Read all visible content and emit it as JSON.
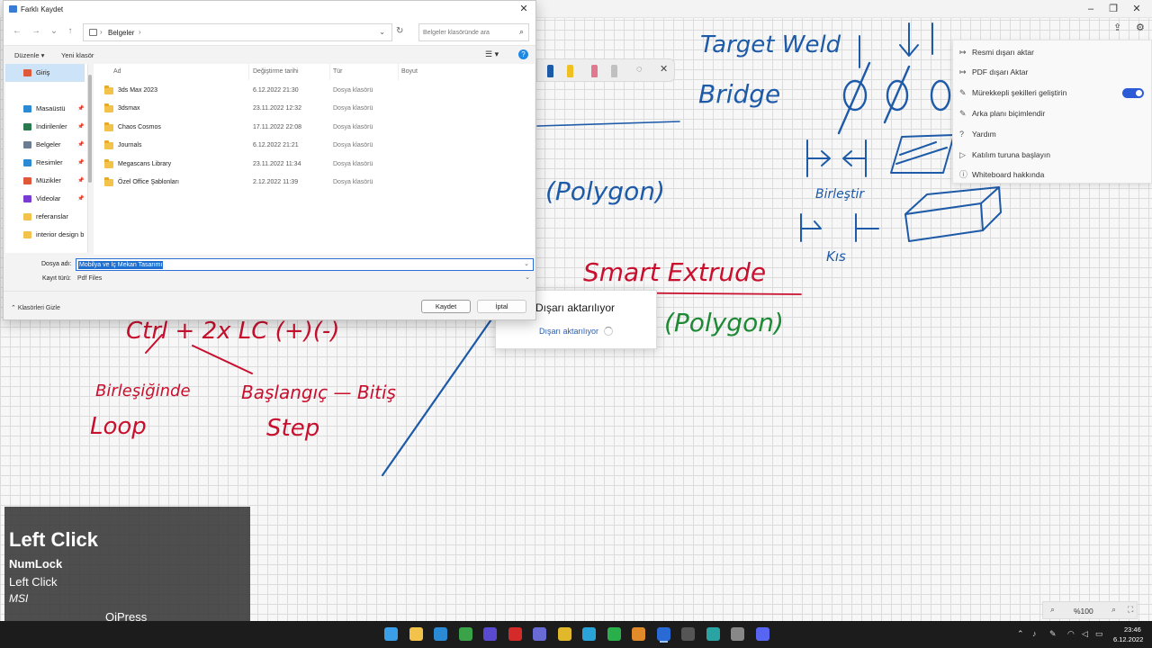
{
  "save_dialog": {
    "title": "Farklı Kaydet",
    "address_path": "Belgeler",
    "search_placeholder": "Belgeler klasöründe ara",
    "cmd_organize": "Düzenle",
    "cmd_new_folder": "Yeni klasör",
    "help": "?",
    "nav_items": [
      {
        "label": "Giriş",
        "icon": "home-icon",
        "color": "#e05a3a"
      },
      {
        "label": "Masaüstü",
        "icon": "desktop-icon",
        "color": "#2a8ad4"
      },
      {
        "label": "İndirilenler",
        "icon": "download-icon",
        "color": "#2a7a50"
      },
      {
        "label": "Belgeler",
        "icon": "documents-icon",
        "color": "#6b7c93"
      },
      {
        "label": "Resimler",
        "icon": "pictures-icon",
        "color": "#2a8ad4"
      },
      {
        "label": "Müzikler",
        "icon": "music-icon",
        "color": "#e0573a"
      },
      {
        "label": "Videolar",
        "icon": "videos-icon",
        "color": "#7a3ad4"
      },
      {
        "label": "referanslar",
        "icon": "folder-icon",
        "color": "#f2c24b"
      },
      {
        "label": "interior design b",
        "icon": "folder-icon",
        "color": "#f2c24b"
      }
    ],
    "columns": {
      "name": "Ad",
      "date": "Değiştirme tarihi",
      "type": "Tür",
      "size": "Boyut"
    },
    "files": [
      {
        "name": "3ds Max 2023",
        "date": "6.12.2022 21:30",
        "type": "Dosya klasörü"
      },
      {
        "name": "3dsmax",
        "date": "23.11.2022 12:32",
        "type": "Dosya klasörü"
      },
      {
        "name": "Chaos Cosmos",
        "date": "17.11.2022 22:08",
        "type": "Dosya klasörü"
      },
      {
        "name": "Journals",
        "date": "6.12.2022 21:21",
        "type": "Dosya klasörü"
      },
      {
        "name": "Megascans Library",
        "date": "23.11.2022 11:34",
        "type": "Dosya klasörü"
      },
      {
        "name": "Özel Office Şablonları",
        "date": "2.12.2022 11:39",
        "type": "Dosya klasörü"
      }
    ],
    "filename_label": "Dosya adı:",
    "filename_value": "Mobilya ve İç Mekan Tasarımı",
    "filetype_label": "Kayıt türü:",
    "filetype_value": "Pdf Files",
    "hide_folders": "Klasörleri Gizle",
    "save_button": "Kaydet",
    "cancel_button": "İptal"
  },
  "wb_menu": [
    {
      "label": "Resmi dışarı aktar",
      "icon": "export-image-icon"
    },
    {
      "label": "PDF dışarı Aktar",
      "icon": "export-pdf-icon"
    },
    {
      "label": "Mürekkepli şekilleri geliştirin",
      "icon": "ink-shape-icon",
      "toggle_on": true
    },
    {
      "label": "Arka planı biçimlendir",
      "icon": "background-icon"
    },
    {
      "label": "Yardım",
      "icon": "help-icon"
    },
    {
      "label": "Katılım turuna başlayın",
      "icon": "play-icon"
    },
    {
      "label": "Whiteboard hakkında",
      "icon": "info-icon"
    }
  ],
  "export_dialog": {
    "title": "Dışarı aktarılıyor",
    "status": "Dışarı aktarılıyor"
  },
  "ink_text": {
    "target_weld": "Target Weld",
    "bridge": "Bridge",
    "polygon_blue": "(Polygon)",
    "smart_extrude": "Smart Extrude",
    "polygon_green": "(Polygon)",
    "ctrl_line": "Ctrl + 2x LC (+)(-)",
    "birlestir": "Birleştir",
    "kis": "Kıs",
    "birlesiginde": "Birleşiğinde",
    "loop": "Loop",
    "baslangic": "Başlangıç — Bitiş",
    "step": "Step"
  },
  "key_overlay": {
    "line1": "Left Click",
    "line2": "NumLock",
    "line3": "Left Click",
    "line4": "MSI",
    "brand": "QiPress"
  },
  "zoom": {
    "value": "%100",
    "minus": "−",
    "plus": "+"
  },
  "taskbar": {
    "time": "23:46",
    "date": "6.12.2022",
    "apps": [
      {
        "name": "start-icon",
        "color": "#3a9ee8"
      },
      {
        "name": "file-explorer-icon",
        "color": "#f2c24b"
      },
      {
        "name": "edge-icon",
        "color": "#2a8ad4"
      },
      {
        "name": "upwork-icon",
        "color": "#3aa34a"
      },
      {
        "name": "obs-icon",
        "color": "#5a4ad0"
      },
      {
        "name": "anydesk-icon",
        "color": "#d42a2a"
      },
      {
        "name": "teams-icon",
        "color": "#6a6ad4"
      },
      {
        "name": "chrome-icon",
        "color": "#e0b82a"
      },
      {
        "name": "telegram-icon",
        "color": "#2aa3d8"
      },
      {
        "name": "whatsapp-icon",
        "color": "#2ab04a"
      },
      {
        "name": "app-orange-icon",
        "color": "#e08a2a"
      },
      {
        "name": "whiteboard-icon",
        "color": "#2a6ad4"
      },
      {
        "name": "xd-icon",
        "color": "#555555"
      },
      {
        "name": "3dsmax-icon",
        "color": "#2aa3a3"
      },
      {
        "name": "app-gear-icon",
        "color": "#888888"
      },
      {
        "name": "discord-icon",
        "color": "#5865f2"
      }
    ]
  }
}
